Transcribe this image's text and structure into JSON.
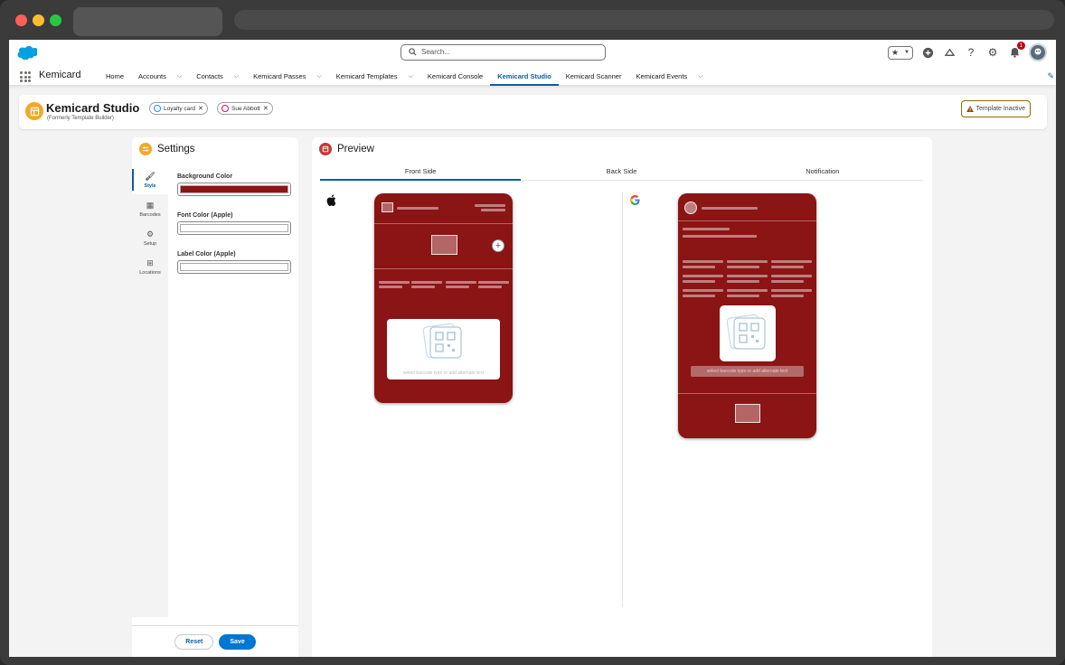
{
  "window": {
    "tab_title": "",
    "url": ""
  },
  "header": {
    "search_placeholder": "Search...",
    "notification_count": "1"
  },
  "nav": {
    "app_name": "Kemicard",
    "items": [
      {
        "label": "Home",
        "has_menu": false
      },
      {
        "label": "Accounts",
        "has_menu": true
      },
      {
        "label": "Contacts",
        "has_menu": true
      },
      {
        "label": "Kemicard Passes",
        "has_menu": true
      },
      {
        "label": "Kemicard Templates",
        "has_menu": true
      },
      {
        "label": "Kemicard Console",
        "has_menu": false
      },
      {
        "label": "Kemicard Studio",
        "has_menu": false,
        "active": true
      },
      {
        "label": "Kemicard Scanner",
        "has_menu": false
      },
      {
        "label": "Kemicard Events",
        "has_menu": true
      }
    ]
  },
  "page_header": {
    "title": "Kemicard Studio",
    "subtitle": "(Formerly Template Builder)",
    "pills": [
      {
        "label": "Loyalty card",
        "color": "#1b96ff"
      },
      {
        "label": "Sue Abbott",
        "color": "#e3066a"
      }
    ],
    "status": "Template Inactive"
  },
  "settings": {
    "title": "Settings",
    "tabs": [
      {
        "label": "Style",
        "icon": "brush-icon",
        "active": true
      },
      {
        "label": "Barcodes",
        "icon": "barcode-icon"
      },
      {
        "label": "Setup",
        "icon": "gear-icon"
      },
      {
        "label": "Locations",
        "icon": "map-icon"
      }
    ],
    "fields": [
      {
        "label": "Background Color",
        "value": "#8b1414"
      },
      {
        "label": "Font Color (Apple)",
        "value": "#ffffff"
      },
      {
        "label": "Label Color (Apple)",
        "value": "#ffffff"
      }
    ],
    "reset_label": "Reset",
    "save_label": "Save"
  },
  "preview": {
    "title": "Preview",
    "tabs": [
      {
        "label": "Front Side",
        "active": true
      },
      {
        "label": "Back Side"
      },
      {
        "label": "Notification"
      }
    ],
    "apple_barcode_hint": "select barcode type or add alternate text",
    "google_barcode_hint": "select barcode type or add alternate text"
  },
  "colors": {
    "brand": "#0176d3",
    "card_background": "#8b1414",
    "studio_icon": "#f4a72a",
    "warning": "#8c6b00"
  }
}
